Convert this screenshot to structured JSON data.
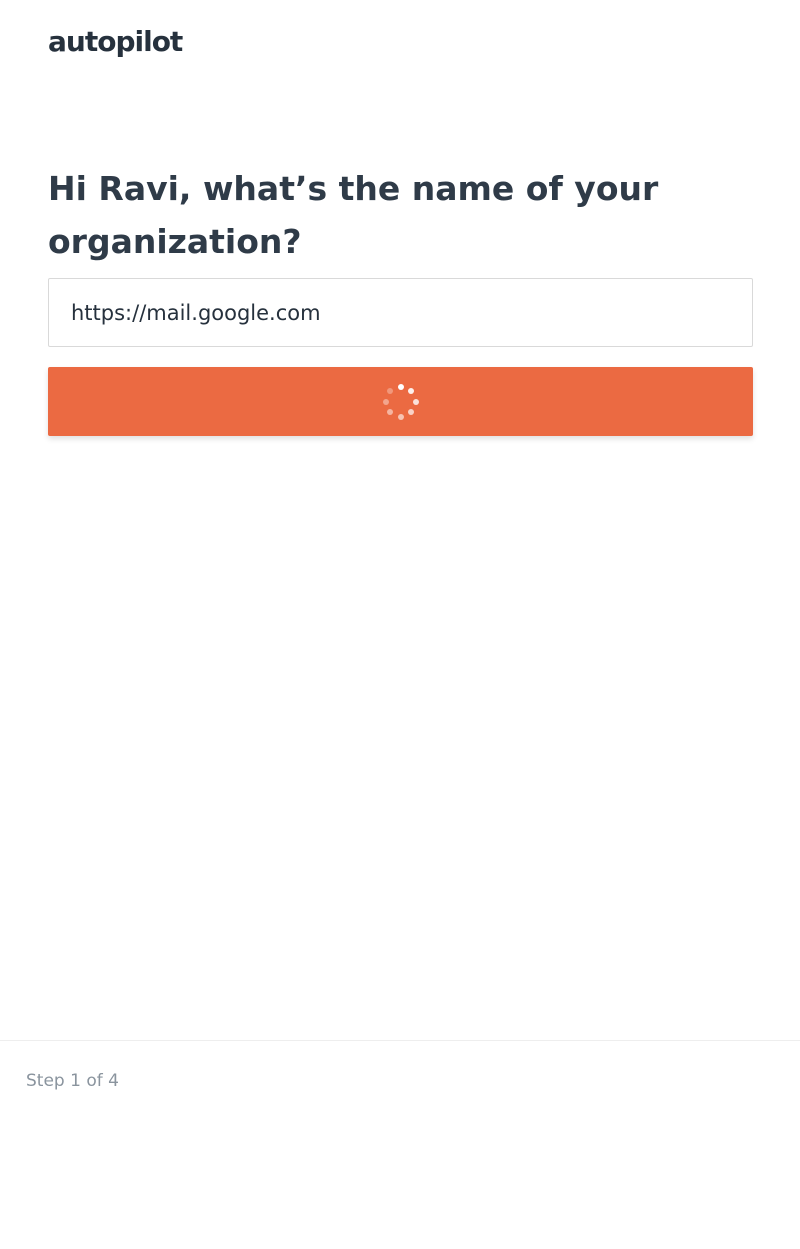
{
  "brand": {
    "logo_text": "autopilot"
  },
  "form": {
    "heading": "Hi Ravi, what’s the name of your organization?",
    "org_input_value": "https://mail.google.com",
    "button_state": "loading",
    "button_color": "#eb6a42"
  },
  "footer": {
    "step_text": "Step 1 of 4"
  },
  "icons": {
    "spinner": "loading-spinner-icon"
  }
}
